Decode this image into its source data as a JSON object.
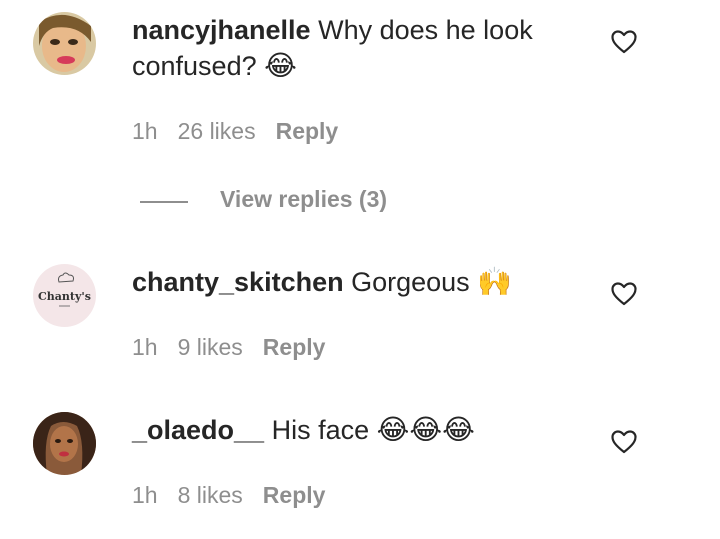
{
  "comments": [
    {
      "username": "nancyjhanelle",
      "text": "Why does he look confused?",
      "emoji": "😂",
      "time": "1h",
      "likes": "26 likes",
      "reply_label": "Reply"
    },
    {
      "username": "chanty_skitchen",
      "text": "Gorgeous",
      "emoji": "🙌",
      "time": "1h",
      "likes": "9 likes",
      "reply_label": "Reply",
      "avatar_text": "Chanty's"
    },
    {
      "username": "_olaedo__",
      "text": "His face",
      "emoji": "😂😂😂",
      "time": "1h",
      "likes": "8 likes",
      "reply_label": "Reply"
    }
  ],
  "view_replies": "View replies (3)",
  "colors": {
    "text": "#262626",
    "muted": "#8e8e8e",
    "background": "#ffffff"
  }
}
